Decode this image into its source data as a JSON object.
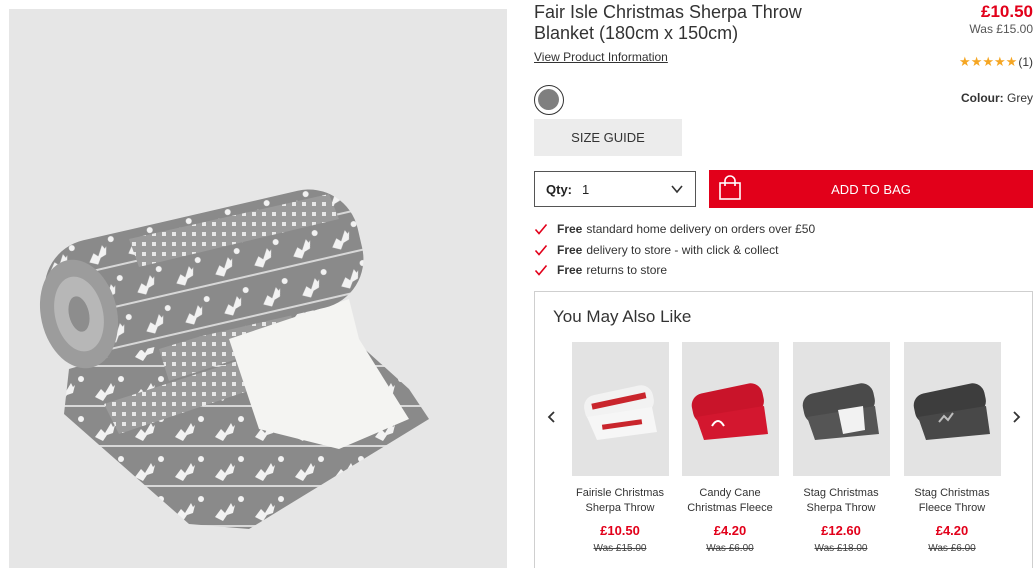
{
  "product": {
    "title": "Fair Isle Christmas Sherpa Throw Blanket (180cm x 150cm)",
    "price_now": "£10.50",
    "price_was": "Was £15.00",
    "view_info_label": "View Product Information",
    "rating_stars": "★★★★★",
    "rating_count": "(1)",
    "colour_label": "Colour:",
    "colour_value": "Grey",
    "swatch_color": "#7f7f7f",
    "size_guide_label": "SIZE GUIDE",
    "qty_label": "Qty:",
    "qty_value": "1",
    "add_to_bag_label": "ADD TO BAG",
    "accent_color": "#e2001a"
  },
  "benefits": [
    {
      "bold": "Free",
      "text": "standard home delivery on orders over £50"
    },
    {
      "bold": "Free",
      "text": "delivery to store - with click & collect"
    },
    {
      "bold": "Free",
      "text": "returns to store"
    }
  ],
  "recommendations": {
    "title": "You May Also Like",
    "items": [
      {
        "name": "Fairisle Christmas Sherpa Throw",
        "price": "£10.50",
        "was": "Was £15.00"
      },
      {
        "name": "Candy Cane Christmas Fleece",
        "price": "£4.20",
        "was": "Was £6.00"
      },
      {
        "name": "Stag Christmas Sherpa Throw",
        "price": "£12.60",
        "was": "Was £18.00"
      },
      {
        "name": "Stag Christmas Fleece Throw",
        "price": "£4.20",
        "was": "Was £6.00"
      }
    ]
  }
}
